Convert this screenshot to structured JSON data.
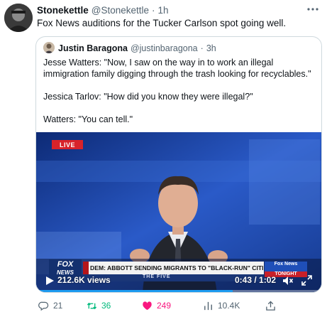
{
  "tweet": {
    "author_name": "Stonekettle",
    "author_handle": "@Stonekettle",
    "separator": "·",
    "time": "1h",
    "text": "Fox News auditions for the Tucker Carlson spot going well.",
    "more_icon": "more-horizontal-icon"
  },
  "quote": {
    "author_name": "Justin Baragona",
    "author_handle": "@justinbaragona",
    "separator": "·",
    "time": "3h",
    "lines": [
      "Jesse Watters: \"Now, I saw on the way in to work an illegal immigration family digging through the trash looking for recyclables.\"",
      "Jessica Tarlov: \"How did you know they were illegal?\"",
      "Watters: \"You can tell.\""
    ]
  },
  "video": {
    "live_badge": "LIVE",
    "chyron_text": "DEM: ABBOTT SENDING MIGRANTS TO \"BLACK-RUN\" CITIES",
    "network_logo_top": "FOX",
    "network_logo_bottom": "NEWS",
    "show_name": "THE FIVE",
    "corner_badge_top": "Fox News",
    "corner_badge_bottom": "TONIGHT",
    "views": "212.6K views",
    "timecode": "0:43 / 1:02",
    "progress": 0.69,
    "accent_color": "#1d9bf0"
  },
  "actions": {
    "replies": "21",
    "retweets": "36",
    "likes": "249",
    "views": "10.4K",
    "reply_icon": "reply-icon",
    "retweet_icon": "retweet-icon",
    "like_icon": "heart-icon",
    "views_icon": "bar-chart-icon",
    "share_icon": "share-icon",
    "retweet_color": "#00ba7c",
    "like_color": "#f91880"
  }
}
